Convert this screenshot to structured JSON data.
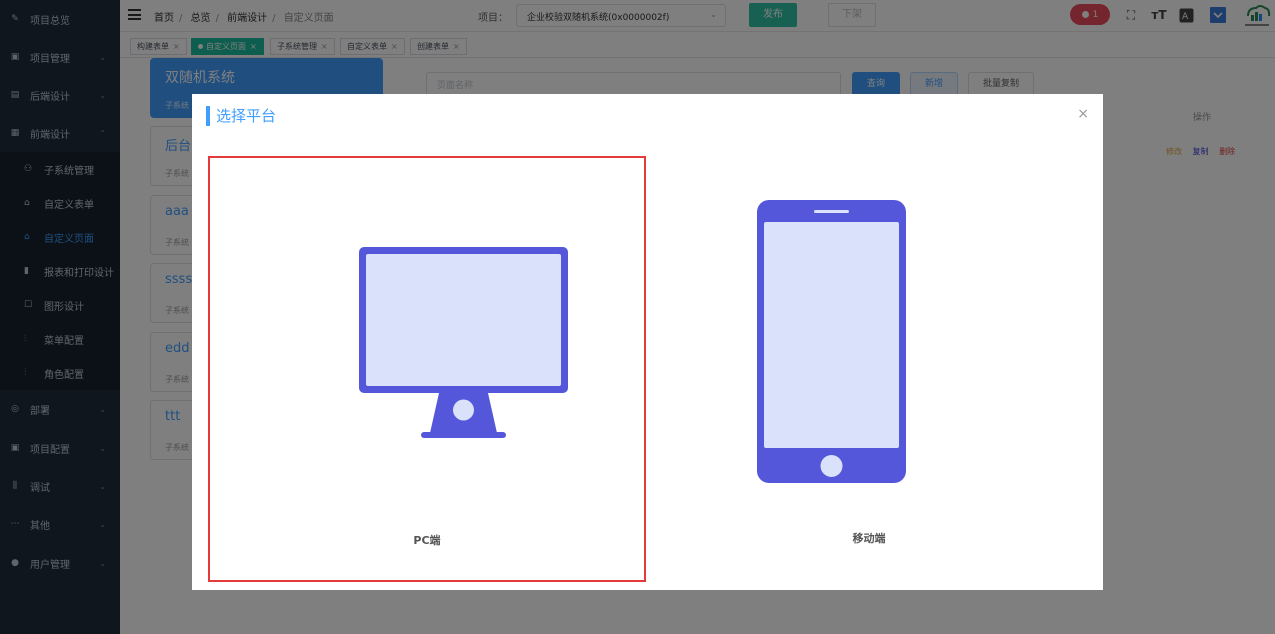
{
  "sidebar": {
    "items": [
      {
        "label": "项目总览",
        "icon": "edit-icon",
        "chevron": false
      },
      {
        "label": "项目管理",
        "icon": "folder-icon",
        "chevron": true
      },
      {
        "label": "后端设计",
        "icon": "document-icon",
        "chevron": true
      },
      {
        "label": "前端设计",
        "icon": "layout-icon",
        "chevron": true,
        "expanded": true
      }
    ],
    "subitems": [
      {
        "label": "子系统管理",
        "icon": "tree-icon"
      },
      {
        "label": "自定义表单",
        "icon": "form-icon"
      },
      {
        "label": "自定义页面",
        "icon": "page-icon",
        "active": true
      },
      {
        "label": "报表和打印设计",
        "icon": "trash-icon"
      },
      {
        "label": "图形设计",
        "icon": "edit-square-icon"
      },
      {
        "label": "菜单配置",
        "icon": "sliders-icon"
      },
      {
        "label": "角色配置",
        "icon": "sliders-icon"
      }
    ],
    "lower_items": [
      {
        "label": "部署",
        "icon": "target-icon",
        "chevron": true
      },
      {
        "label": "项目配置",
        "icon": "calendar-icon",
        "chevron": true
      },
      {
        "label": "调试",
        "icon": "bars-icon",
        "chevron": true
      },
      {
        "label": "其他",
        "icon": "ellipsis-icon",
        "chevron": true
      },
      {
        "label": "用户管理",
        "icon": "user-icon",
        "chevron": true
      }
    ]
  },
  "header": {
    "breadcrumb": [
      "首页",
      "总览",
      "前端设计",
      "自定义页面"
    ],
    "project_label": "项目：",
    "project_value": "企业校验双随机系统(0x0000002f)",
    "publish_label": "发布",
    "offline_label": "下架",
    "notification_count": "1"
  },
  "tabs": [
    {
      "label": "构建表单",
      "active": false
    },
    {
      "label": "自定义页面",
      "active": true
    },
    {
      "label": "子系统管理",
      "active": false
    },
    {
      "label": "自定义表单",
      "active": false
    },
    {
      "label": "创建表单",
      "active": false
    }
  ],
  "content": {
    "cards": [
      {
        "title": "双随机系统",
        "sub": "子系统",
        "selected": true
      },
      {
        "title": "后台",
        "sub": "子系统",
        "selected": false
      },
      {
        "title": "aaa",
        "sub": "子系统",
        "selected": false
      },
      {
        "title": "ssss",
        "sub": "子系统",
        "selected": false
      },
      {
        "title": "edd",
        "sub": "子系统",
        "selected": false
      },
      {
        "title": "ttt",
        "sub": "子系统",
        "selected": false
      }
    ],
    "search_placeholder": "页面名称",
    "query_label": "查询",
    "new_label": "新增",
    "batch_copy_label": "批量复制",
    "op_header": "操作",
    "op_links": {
      "edit": "修改",
      "copy": "复制",
      "delete": "删除"
    }
  },
  "modal": {
    "title": "选择平台",
    "close": "×",
    "options": [
      {
        "label": "PC端",
        "icon": "monitor-icon",
        "selected": true
      },
      {
        "label": "移动端",
        "icon": "mobile-phone-icon",
        "selected": false
      }
    ]
  },
  "colors": {
    "sidebar_bg": "#1f2d3d",
    "accent": "#409eff",
    "teal": "#1abc9c",
    "device_dark": "#5457d9",
    "device_light": "#d9e1fb",
    "selected_border": "#e33b3b"
  }
}
